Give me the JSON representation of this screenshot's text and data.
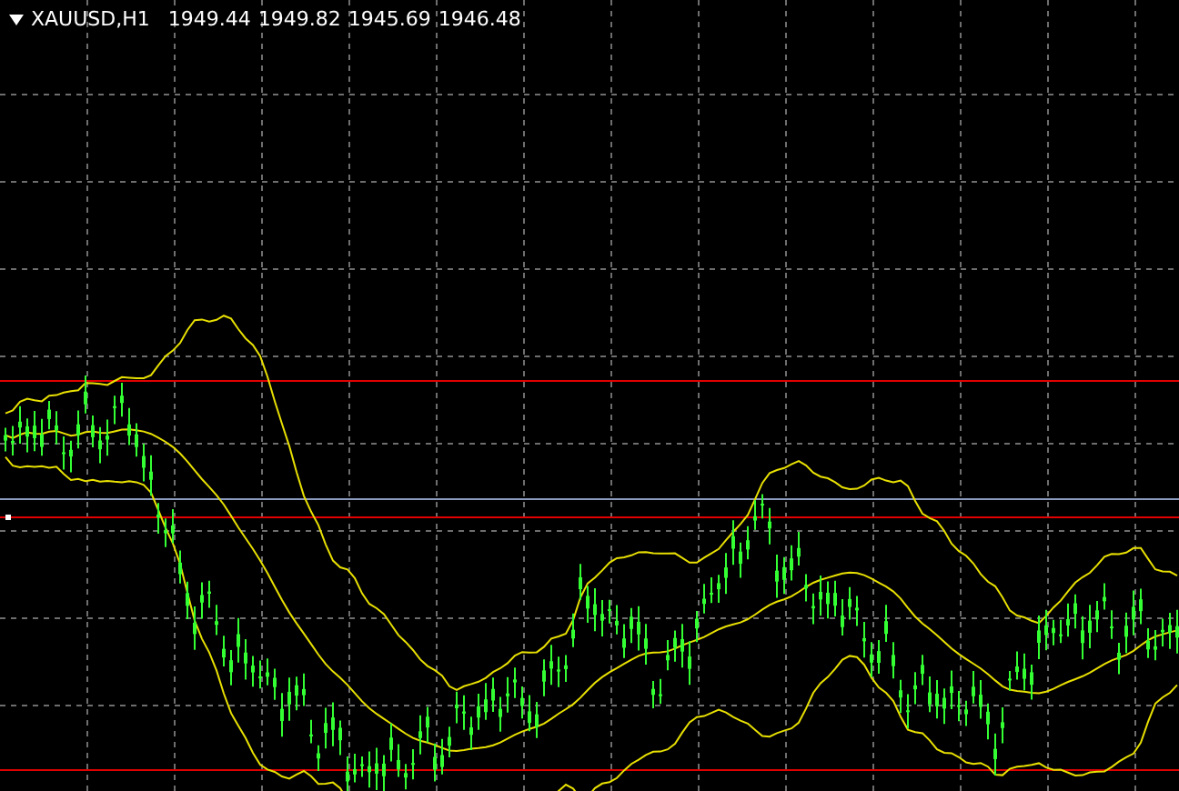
{
  "chart": {
    "symbol": "XAUUSD,H1",
    "open": "1949.44",
    "high": "1949.82",
    "low": "1945.69",
    "close": "1946.48"
  }
}
